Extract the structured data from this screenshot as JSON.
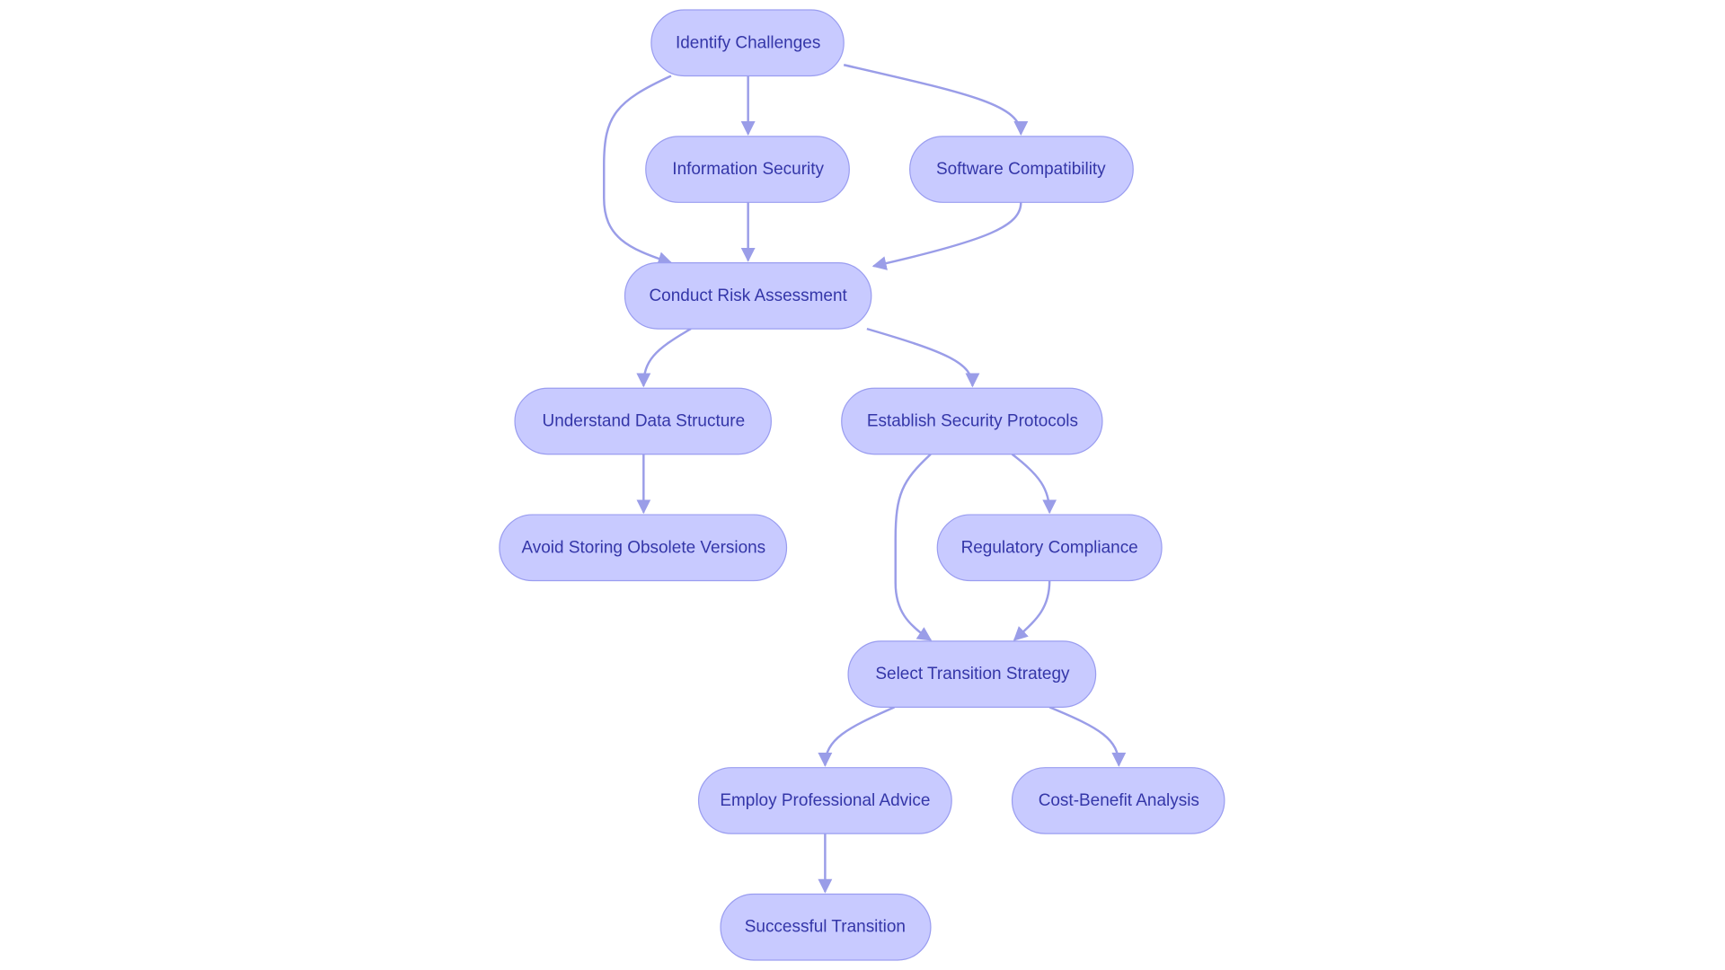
{
  "diagram": {
    "colors": {
      "node_fill": "#c8caff",
      "node_stroke": "#9a9df0",
      "edge": "#9a9de8",
      "text": "#3436a8"
    },
    "nodes": [
      {
        "id": "identify",
        "label": "Identify Challenges"
      },
      {
        "id": "infosec",
        "label": "Information Security"
      },
      {
        "id": "software",
        "label": "Software Compatibility"
      },
      {
        "id": "risk",
        "label": "Conduct Risk Assessment"
      },
      {
        "id": "datastruct",
        "label": "Understand Data Structure"
      },
      {
        "id": "protocols",
        "label": "Establish Security Protocols"
      },
      {
        "id": "obsolete",
        "label": "Avoid Storing Obsolete Versions"
      },
      {
        "id": "compliance",
        "label": "Regulatory Compliance"
      },
      {
        "id": "strategy",
        "label": "Select Transition Strategy"
      },
      {
        "id": "advice",
        "label": "Employ Professional Advice"
      },
      {
        "id": "costbenefit",
        "label": "Cost-Benefit Analysis"
      },
      {
        "id": "success",
        "label": "Successful Transition"
      }
    ],
    "edges": [
      [
        "identify",
        "infosec"
      ],
      [
        "identify",
        "software"
      ],
      [
        "identify",
        "risk"
      ],
      [
        "infosec",
        "risk"
      ],
      [
        "software",
        "risk"
      ],
      [
        "risk",
        "datastruct"
      ],
      [
        "risk",
        "protocols"
      ],
      [
        "datastruct",
        "obsolete"
      ],
      [
        "protocols",
        "compliance"
      ],
      [
        "protocols",
        "strategy"
      ],
      [
        "compliance",
        "strategy"
      ],
      [
        "strategy",
        "advice"
      ],
      [
        "strategy",
        "costbenefit"
      ],
      [
        "advice",
        "success"
      ]
    ]
  }
}
